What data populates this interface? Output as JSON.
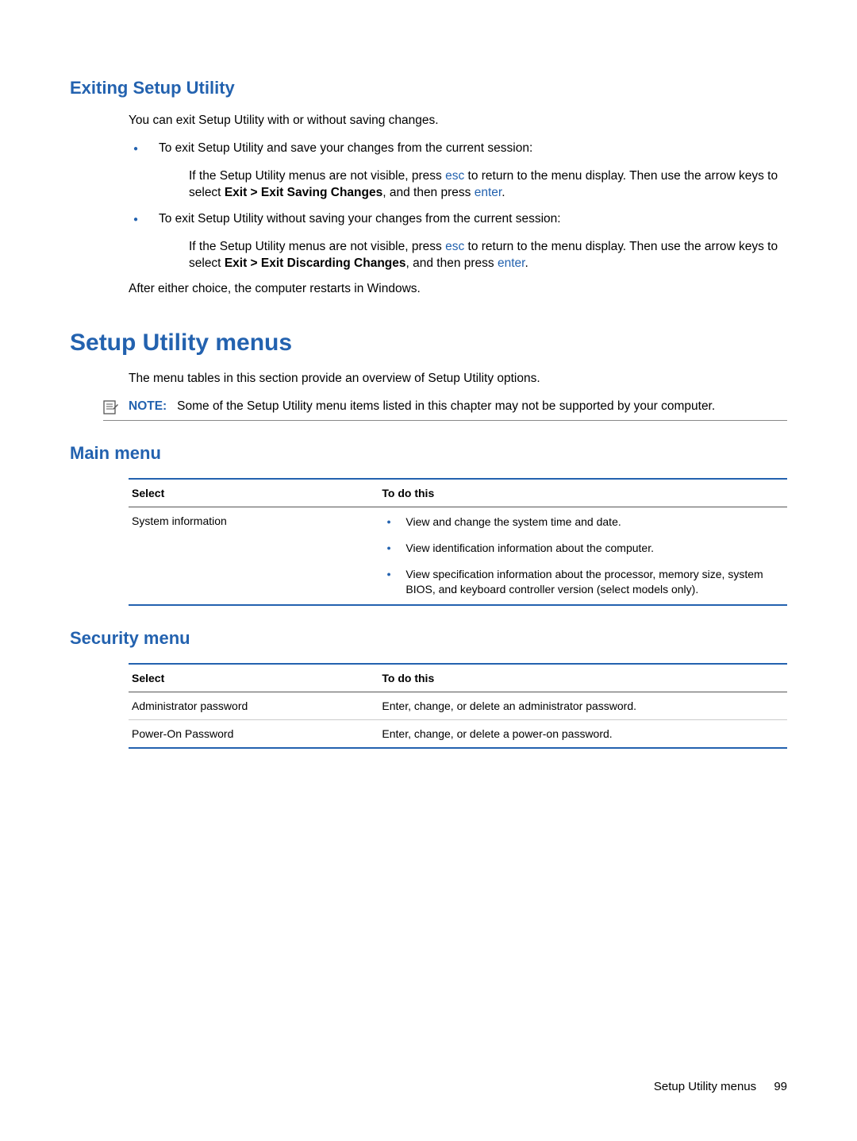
{
  "section1": {
    "heading": "Exiting Setup Utility",
    "intro": "You can exit Setup Utility with or without saving changes.",
    "bullets": [
      {
        "lead": "To exit Setup Utility and save your changes from the current session:",
        "detail_pre": "If the Setup Utility menus are not visible, press ",
        "key1": "esc",
        "detail_mid": " to return to the menu display. Then use the arrow keys to select ",
        "bold1": "Exit > Exit Saving Changes",
        "detail_mid2": ", and then press ",
        "key2": "enter",
        "detail_post": "."
      },
      {
        "lead": "To exit Setup Utility without saving your changes from the current session:",
        "detail_pre": "If the Setup Utility menus are not visible, press ",
        "key1": "esc",
        "detail_mid": " to return to the menu display. Then use the arrow keys to select ",
        "bold1": "Exit > Exit Discarding Changes",
        "detail_mid2": ", and then press ",
        "key2": "enter",
        "detail_post": "."
      }
    ],
    "outro": "After either choice, the computer restarts in Windows."
  },
  "section2": {
    "heading": "Setup Utility menus",
    "intro": "The menu tables in this section provide an overview of Setup Utility options.",
    "note_label": "NOTE:",
    "note_body": "Some of the Setup Utility menu items listed in this chapter may not be supported by your computer."
  },
  "main_menu": {
    "heading": "Main menu",
    "col1": "Select",
    "col2": "To do this",
    "rows": [
      {
        "select": "System information",
        "todo_bullets": [
          "View and change the system time and date.",
          "View identification information about the computer.",
          "View specification information about the processor, memory size, system BIOS, and keyboard controller version (select models only)."
        ]
      }
    ]
  },
  "security_menu": {
    "heading": "Security menu",
    "col1": "Select",
    "col2": "To do this",
    "rows": [
      {
        "select": "Administrator password",
        "todo": "Enter, change, or delete an administrator password."
      },
      {
        "select": "Power-On Password",
        "todo": "Enter, change, or delete a power-on password."
      }
    ]
  },
  "footer": {
    "label": "Setup Utility menus",
    "page": "99"
  }
}
